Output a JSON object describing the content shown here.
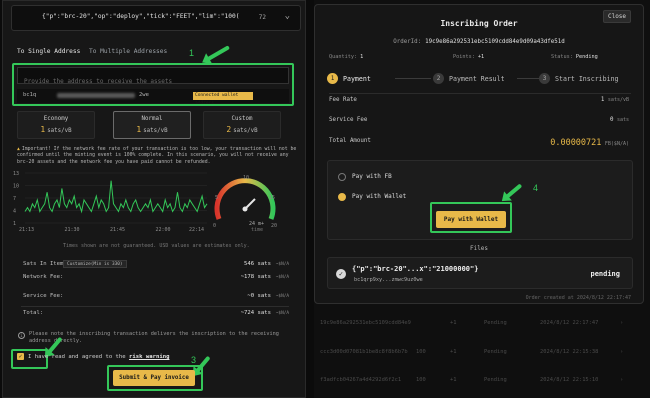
{
  "left": {
    "json_text": "{\"p\":\"brc-20\",\"op\":\"deploy\",\"tick\":\"FEET\",\"lim\":\"100(",
    "json_count": "72",
    "tabs": [
      "To Single Address",
      "To Multiple Addresses"
    ],
    "address_placeholder": "Provide the address to receive the assets",
    "wallet_address_prefix": "bc1q",
    "wallet_address_suffix": "2we",
    "wallet_badge": "Connected wallet address",
    "fees": [
      {
        "name": "Economy",
        "value": "1",
        "unit": "sats/vB"
      },
      {
        "name": "Normal",
        "value": "1",
        "unit": "sats/vB"
      },
      {
        "name": "Custom",
        "value": "2",
        "unit": "sats/vB"
      }
    ],
    "warning": "Important! If the network fee rate of your transaction is too low, your transaction will not be confirmed until the minting event is 100% complete. In this scenario, you will not receive any brc-20 assets and the network fee you have paid cannot be refunded.",
    "chart_data": {
      "type": "line",
      "ylim": [
        0,
        13
      ],
      "yticks": [
        "13",
        "10",
        "7",
        "4",
        "1"
      ],
      "xticks": [
        "21:13",
        "21:30",
        "21:45",
        "22:00",
        "22:14"
      ],
      "series": [
        {
          "values": [
            3,
            4,
            3,
            5,
            4,
            6,
            3,
            4,
            5,
            8,
            4,
            3,
            5,
            6,
            4,
            9,
            5,
            4,
            6,
            5,
            7,
            4,
            5,
            3,
            6,
            5,
            4,
            3,
            5,
            7,
            4,
            6,
            5,
            3,
            4,
            11,
            5,
            4,
            3,
            5,
            4,
            6,
            4,
            3,
            5,
            6,
            4,
            3,
            4,
            5,
            4,
            6,
            3,
            4,
            5,
            4,
            3,
            6,
            4,
            5,
            3,
            4,
            8,
            4,
            3,
            5,
            4,
            6,
            5,
            4,
            3,
            5,
            7,
            4,
            5
          ]
        }
      ]
    },
    "gauge": {
      "ticks": [
        "0",
        "5",
        "10",
        "15",
        "20"
      ],
      "center_value": "24 m+",
      "center_label": "time"
    },
    "chart_note": "Times shown are not guaranteed. USD values are estimates only.",
    "summary": [
      {
        "label": "Sats In Item:",
        "value": "546 sats",
        "unit": "~$N/A",
        "customize": "Customize(Min is 330)"
      },
      {
        "label": "Network Fee:",
        "value": "~178 sats",
        "unit": "~$N/A"
      },
      {
        "label": "Service Fee:",
        "value": "~0 sats",
        "unit": "~$N/A"
      },
      {
        "label": "Total:",
        "value": "~724 sats",
        "unit": "~$N/A"
      }
    ],
    "info_note": "Please note the inscribing transaction delivers the inscription to the receiving address directly.",
    "agree_text": "I have read and agreed to the",
    "risk_link": "risk warning",
    "submit_label": "Submit & Pay invoice",
    "markers": [
      "1",
      "3"
    ]
  },
  "modal": {
    "title": "Inscribing Order",
    "close_label": "Close",
    "orderid_label": "OrderId:",
    "orderid_value": "19c9e86a292531ebc5109cdd84e9d09a43dfe51d",
    "quantity_label": "Quantity:",
    "quantity_value": "1",
    "points_label": "Points:",
    "points_value": "+1",
    "status_label": "Status:",
    "status_value": "Pending",
    "steps": [
      {
        "num": "1",
        "label": "Payment"
      },
      {
        "num": "2",
        "label": "Payment Result"
      },
      {
        "num": "3",
        "label": "Start Inscribing"
      }
    ],
    "fee_rate_label": "Fee Rate",
    "fee_rate_value": "1",
    "fee_rate_unit": "sats/vB",
    "service_fee_label": "Service Fee",
    "service_fee_value": "0",
    "service_fee_unit": "sats",
    "total_label": "Total Amount",
    "total_value": "0.00000721",
    "total_unit": "FB($N/A)",
    "pay_options": [
      "Pay with FB",
      "Pay with Wallet"
    ],
    "pay_button": "Pay with Wallet",
    "files_label": "Files",
    "file_name": "{\"p\":\"brc-20\"...x\":\"21000000\"}",
    "file_addr": "bc1qrp9xy...zmwc9uz0we",
    "file_status": "pending",
    "created": "Order created at 2024/8/12 22:17:47",
    "marker": "4"
  },
  "background_rows": [
    {
      "id": "19c9e86a292531ebc5109cdd84e9",
      "qty": "1",
      "points": "+1",
      "status": "Pending",
      "date": "2024/8/12 22:17:47"
    },
    {
      "id": "ccc3d00d07081b1be8c8f8b6b7b",
      "qty": "100",
      "points": "+1",
      "status": "Pending",
      "date": "2024/8/12 22:15:38"
    },
    {
      "id": "f3adfcb04267a4d4292d6f2c1",
      "qty": "100",
      "points": "+1",
      "status": "Pending",
      "date": "2024/8/12 22:15:10"
    }
  ]
}
